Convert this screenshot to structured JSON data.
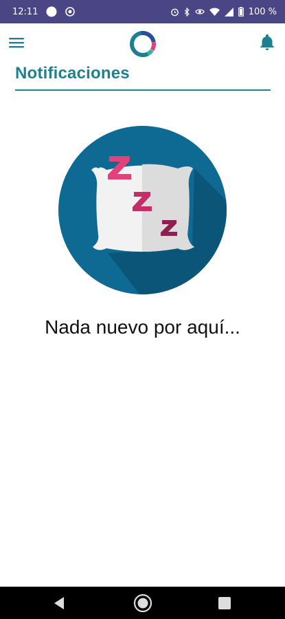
{
  "status_bar": {
    "time": "12:11",
    "battery": "100 %",
    "icons": [
      "circle-notification-icon",
      "app-notification-icon",
      "alarm-icon",
      "bluetooth-icon",
      "eye-icon",
      "wifi-icon",
      "signal-icon",
      "battery-icon"
    ]
  },
  "app_bar": {
    "menu_icon": "hamburger-menu-icon",
    "logo_icon": "app-logo-ring",
    "bell_icon": "bell-icon"
  },
  "page": {
    "title": "Notificaciones"
  },
  "empty_state": {
    "illustration": "sleeping-pillow-zzz",
    "message": "Nada nuevo por aquí..."
  },
  "nav_bar": {
    "icons": [
      "back-icon",
      "home-icon",
      "recents-icon"
    ]
  },
  "colors": {
    "status_bar": "#4a4585",
    "accent": "#1d7f8f",
    "circle": "#0e6a93",
    "zzz_pink": "#e4417a",
    "zzz_purple": "#b5265f"
  }
}
